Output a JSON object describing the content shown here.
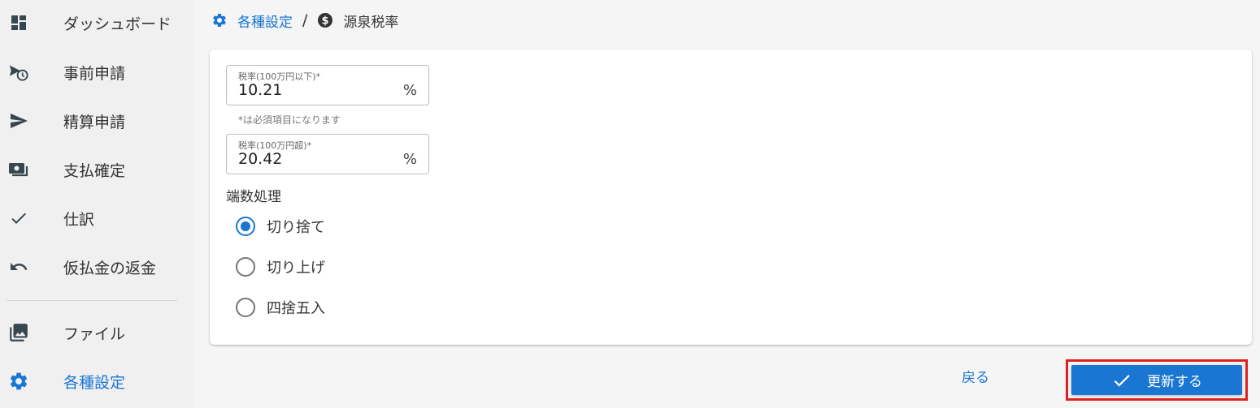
{
  "colors": {
    "accent": "#1976d2",
    "highlight_border": "#e02020",
    "sidebar_bg": "#f0f0f0",
    "icon_dark": "#37474f"
  },
  "sidebar": {
    "items": [
      {
        "label": "ダッシュボード",
        "icon": "dashboard-icon"
      },
      {
        "label": "事前申請",
        "icon": "flight-schedule-icon"
      },
      {
        "label": "精算申請",
        "icon": "send-icon"
      },
      {
        "label": "支払確定",
        "icon": "payments-icon"
      },
      {
        "label": "仕訳",
        "icon": "check-icon"
      },
      {
        "label": "仮払金の返金",
        "icon": "undo-icon"
      },
      {
        "label": "ファイル",
        "icon": "photo-library-icon"
      },
      {
        "label": "各種設定",
        "icon": "settings-icon",
        "active": true
      }
    ]
  },
  "breadcrumb": {
    "parent": "各種設定",
    "separator": "/",
    "current": "源泉税率"
  },
  "form": {
    "rate_low": {
      "label": "税率(100万円以下)*",
      "value": "10.21",
      "unit": "%"
    },
    "required_hint": "*は必須項目になります",
    "rate_high": {
      "label": "税率(100万円超)*",
      "value": "20.42",
      "unit": "%"
    },
    "rounding": {
      "title": "端数処理",
      "options": [
        {
          "label": "切り捨て",
          "checked": true
        },
        {
          "label": "切り上げ",
          "checked": false
        },
        {
          "label": "四捨五入",
          "checked": false
        }
      ]
    }
  },
  "actions": {
    "back_label": "戻る",
    "submit_label": "更新する"
  }
}
